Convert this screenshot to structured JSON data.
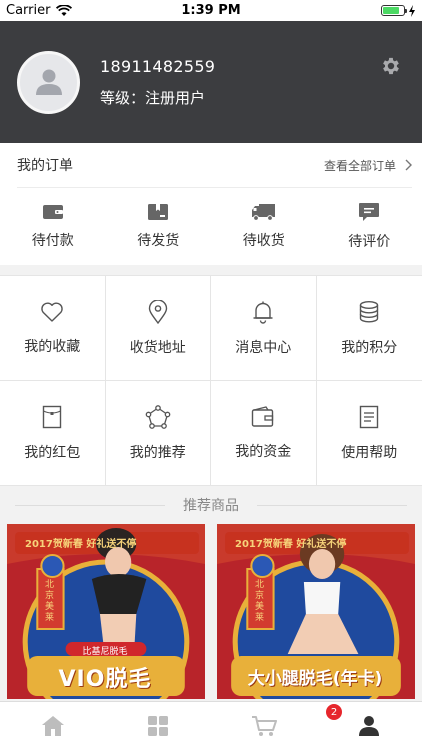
{
  "status_bar": {
    "carrier": "Carrier",
    "time": "1:39 PM",
    "battery_level": 0.8
  },
  "profile": {
    "phone": "18911482559",
    "level": "等级：注册用户"
  },
  "orders": {
    "title": "我的订单",
    "view_all": "查看全部订单",
    "items": [
      {
        "label": "待付款",
        "icon": "wallet-icon"
      },
      {
        "label": "待发货",
        "icon": "package-icon"
      },
      {
        "label": "待收货",
        "icon": "truck-icon"
      },
      {
        "label": "待评价",
        "icon": "comment-icon"
      }
    ]
  },
  "grid": [
    {
      "label": "我的收藏",
      "icon": "heart-icon"
    },
    {
      "label": "收货地址",
      "icon": "location-icon"
    },
    {
      "label": "消息中心",
      "icon": "bell-icon"
    },
    {
      "label": "我的积分",
      "icon": "coins-icon"
    },
    {
      "label": "我的红包",
      "icon": "red-envelope-icon"
    },
    {
      "label": "我的推荐",
      "icon": "network-icon"
    },
    {
      "label": "我的资金",
      "icon": "funds-wallet-icon"
    },
    {
      "label": "使用帮助",
      "icon": "help-doc-icon"
    }
  ],
  "recommend": {
    "title": "推荐商品",
    "products": [
      {
        "banner": "2017贺新春 好礼送不停",
        "brand": "北京美莱",
        "tag": "比基尼脱毛",
        "name": "VIO脱毛"
      },
      {
        "banner": "2017贺新春 好礼送不停",
        "brand": "北京美莱",
        "tag": "",
        "name": "大小腿脱毛(年卡)"
      }
    ]
  },
  "tabbar": {
    "tabs": [
      {
        "name": "home",
        "icon": "home-icon"
      },
      {
        "name": "category",
        "icon": "grid-icon"
      },
      {
        "name": "cart",
        "icon": "cart-icon"
      },
      {
        "name": "profile",
        "icon": "user-icon"
      }
    ],
    "cart_badge": "2"
  },
  "colors": {
    "header_bg": "#3c3d40",
    "accent_red": "#e6262c",
    "icon_gray": "#666666"
  }
}
